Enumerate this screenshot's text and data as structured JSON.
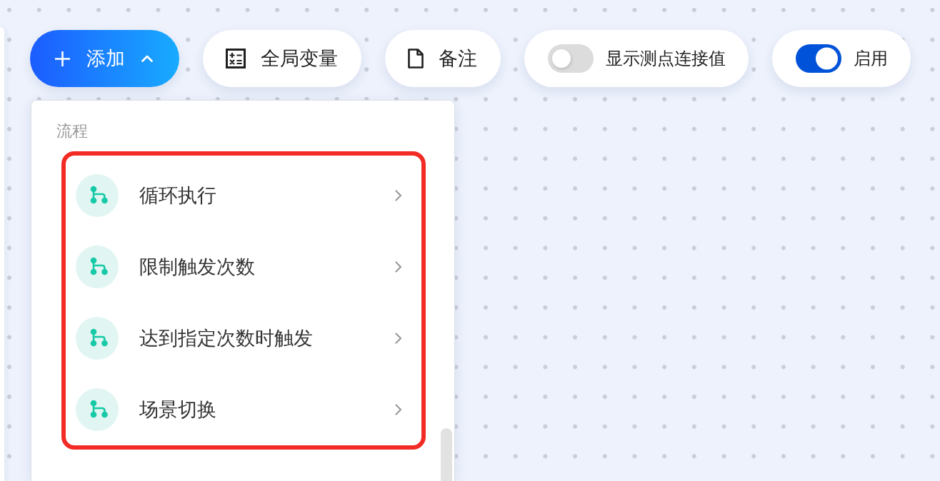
{
  "toolbar": [
    {
      "kind": "primary",
      "label": "添加",
      "expanded": true
    },
    {
      "kind": "button",
      "label": "全局变量"
    },
    {
      "kind": "button",
      "label": "备注"
    },
    {
      "kind": "toggle",
      "label": "显示测点连接值",
      "on": false
    },
    {
      "kind": "toggle",
      "label": "启用",
      "on": true
    }
  ],
  "menu": {
    "sections": [
      {
        "title": "流程",
        "highlighted": true,
        "items": [
          {
            "label": "循环执行"
          },
          {
            "label": "限制触发次数"
          },
          {
            "label": "达到指定次数时触发"
          },
          {
            "label": "场景切换"
          }
        ]
      }
    ]
  }
}
